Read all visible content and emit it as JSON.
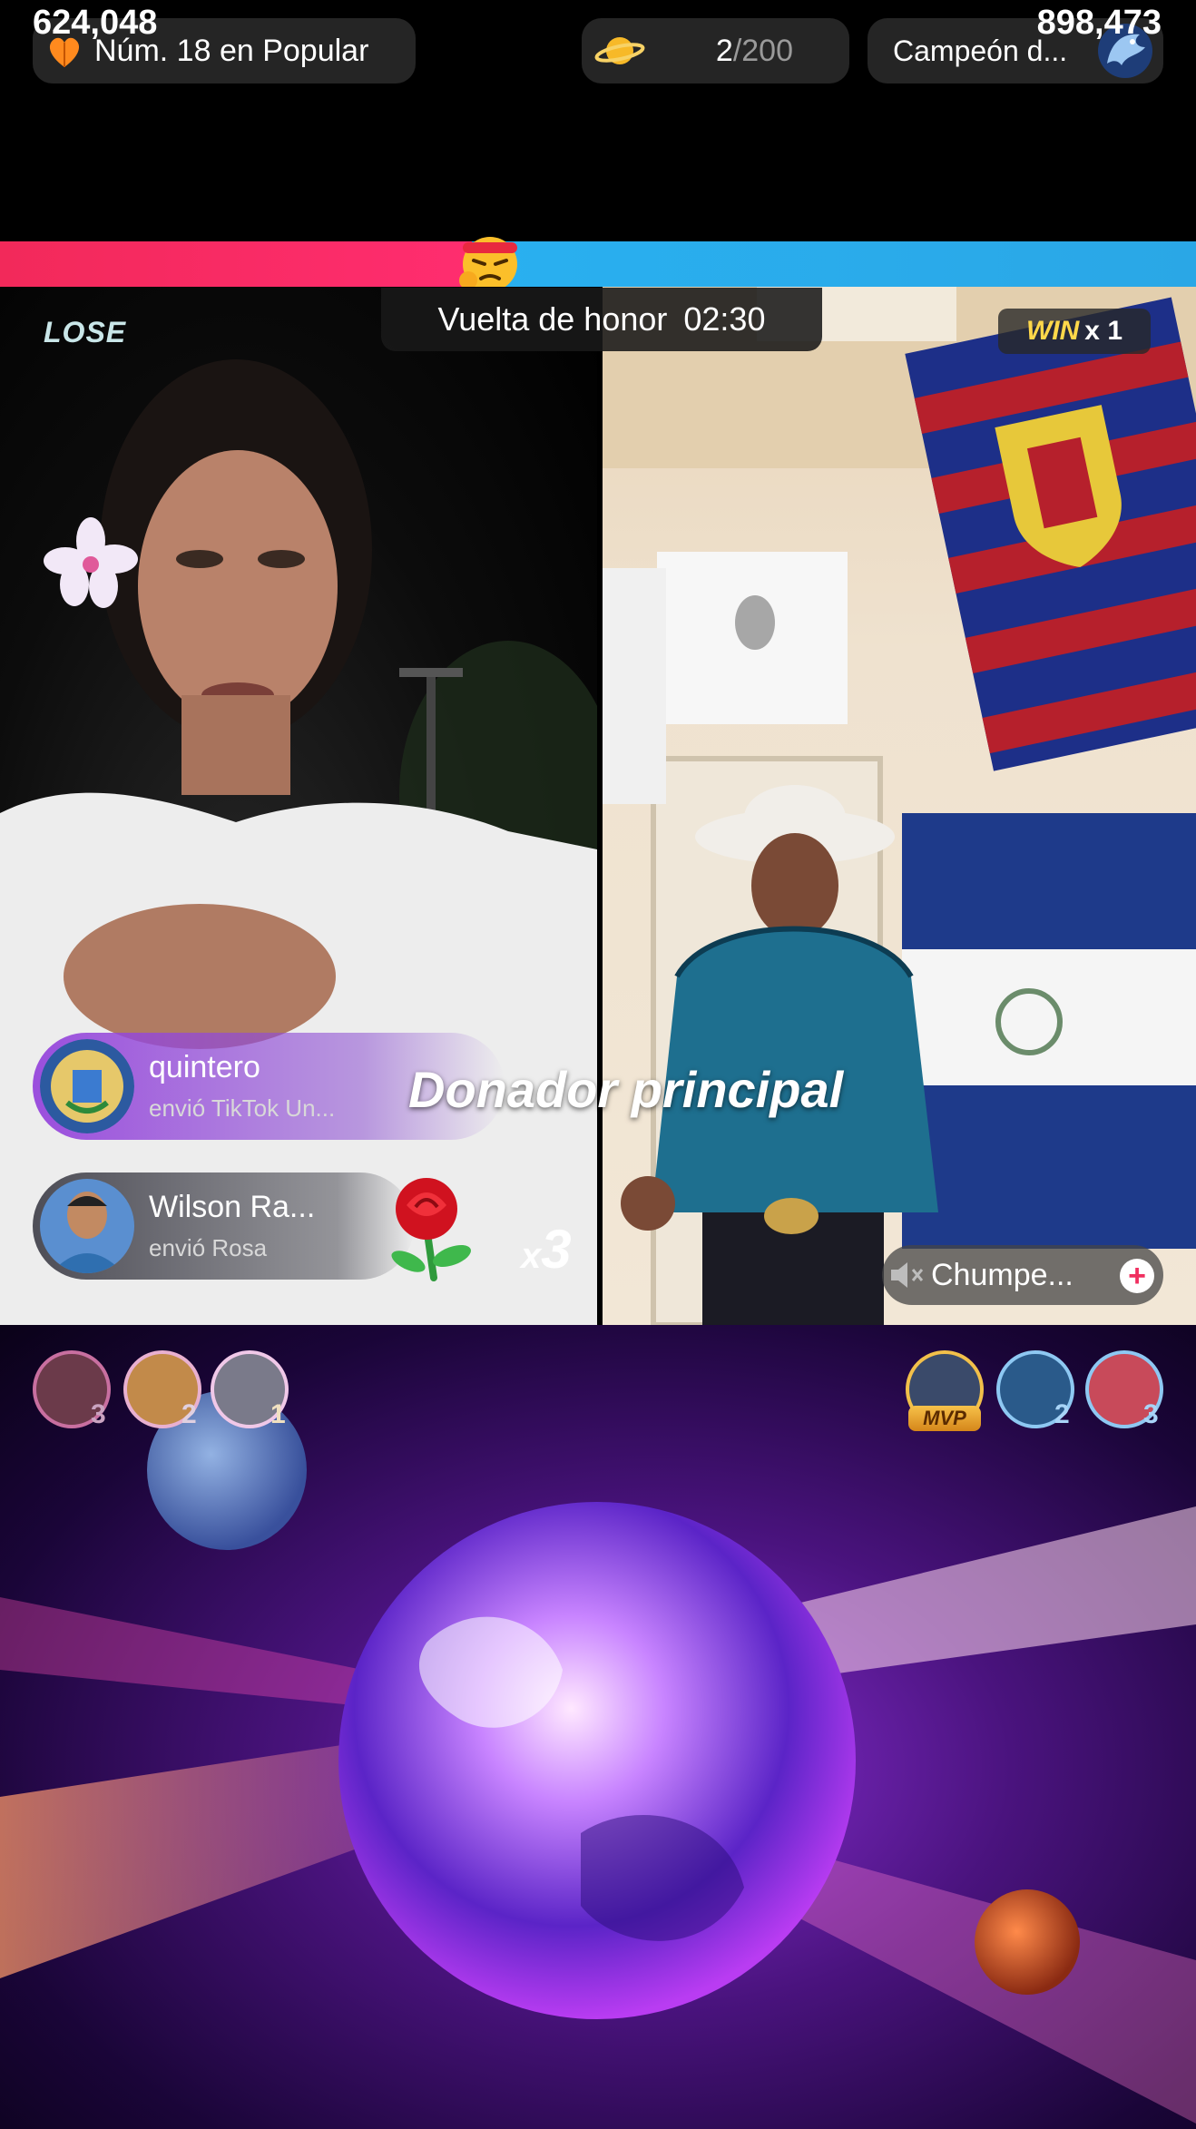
{
  "header": {
    "rank": "Núm. 18 en Popular",
    "progress_current": "2",
    "progress_total": "/200",
    "champion": "Campeón d..."
  },
  "battle": {
    "left_score": "624,048",
    "right_score": "898,473",
    "left_result": "LOSE",
    "timer_label": "Vuelta de honor",
    "timer": "02:30",
    "win_label": "WIN",
    "win_mult": "x 1"
  },
  "gifts": [
    {
      "name": "quintero",
      "text": "envió TikTok Un..."
    },
    {
      "name": "Wilson Ra...",
      "text": "envió Rosa"
    }
  ],
  "gift_multiplier_x": "x",
  "gift_multiplier_n": "3",
  "donor_banner": "Donador principal",
  "follow": {
    "name": "Chumpe..."
  },
  "left_ranking": [
    "3",
    "2",
    "1"
  ],
  "right_ranking": {
    "mvp": "MVP",
    "ranks": [
      "2",
      "3"
    ]
  },
  "colors": {
    "left_team": "#f2295a",
    "right_team": "#29b0f0",
    "gift_purple": "#9646dc"
  },
  "icons": [
    "heart-icon",
    "planet-icon",
    "champion-dragon-icon",
    "battle-emoji-icon",
    "rose-icon",
    "mute-icon",
    "plus-icon"
  ]
}
